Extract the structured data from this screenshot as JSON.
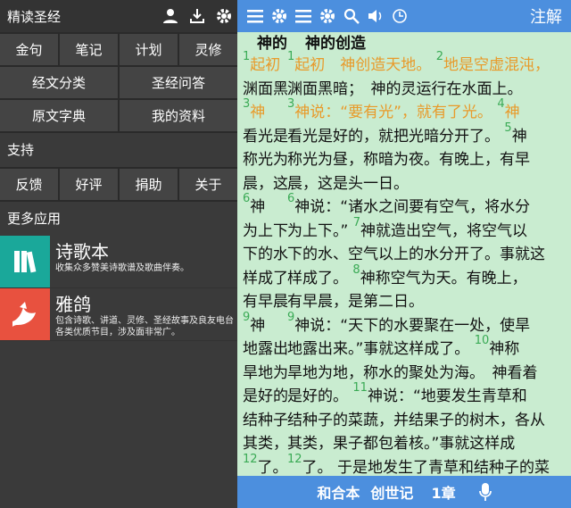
{
  "drawer": {
    "title": "精读圣经",
    "row1": [
      "金句",
      "笔记",
      "计划",
      "灵修"
    ],
    "row2": [
      "经文分类",
      "圣经问答"
    ],
    "row3": [
      "原文字典",
      "我的资料"
    ],
    "support_title": "支持",
    "support": [
      "反馈",
      "好评",
      "捐助",
      "关于"
    ],
    "more_title": "更多应用",
    "apps": [
      {
        "name": "诗歌本",
        "desc": "收集众多赞美诗歌谱及歌曲伴奏。",
        "color": "#1aa89a"
      },
      {
        "name": "雅鸽",
        "desc": "包含诗歌、讲道、灵修、圣经故事及良友电台各类优质节目，涉及面非常广。",
        "color": "#e8513f"
      }
    ]
  },
  "reader": {
    "notes": "注解",
    "heading": "神的创造",
    "partial_heading": "神的",
    "lines": [
      {
        "vn": "1",
        "text": "起初",
        "vn2": "1",
        "text2": "起初　神创造天地。",
        "vn3": "2",
        "text3": "地是空虚混沌，",
        "hl": true
      },
      {
        "text": "渊面黑",
        "text2": "渊面黑暗；　神的灵运行在水面上。"
      },
      {
        "vn": "3",
        "text": "神",
        "vn2": "3",
        "text2": "神说：“要有光”，就有了光。",
        "vn3": "4",
        "text3": "神",
        "hl": true
      },
      {
        "text": "看光是",
        "text2": "看光是好的，就把光暗分开了。",
        "vn3": "5",
        "text3": "神"
      },
      {
        "text": "称光为",
        "text2": "称光为昼，称暗为夜。有晚上，有早"
      },
      {
        "text": "晨，这",
        "text2": "晨，这是头一日。"
      },
      {
        "vn": "6",
        "text": "神",
        "vn2": "6",
        "text2": "神说：“诸水之间要有空气，将水分"
      },
      {
        "text": "为上下",
        "text2": "为上下。”",
        "vn3": "7",
        "text3": "神就造出空气，将空气以"
      },
      {
        "text": "下的水",
        "text2": "下的水、空气以上的水分开了。事就这"
      },
      {
        "text": "样成了",
        "text2": "样成了。",
        "vn3": "8",
        "text3": "神称空气为天。有晚上，"
      },
      {
        "text": "有早晨",
        "text2": "有早晨，是第二日。"
      },
      {
        "vn": "9",
        "text": "神",
        "vn2": "9",
        "text2": "神说：“天下的水要聚在一处，使旱"
      },
      {
        "text": "地露出",
        "text2": "地露出来。”事就这样成了。",
        "vn3": "10",
        "text3": "神称"
      },
      {
        "text": "旱地为",
        "text2": "旱地为地，称水的聚处为海。　神看着"
      },
      {
        "text": "是好的",
        "text2": "是好的。",
        "vn3": "11",
        "text3": "神说：“地要发生青草和"
      },
      {
        "text": "结种子",
        "text2": "结种子的菜蔬，并结果子的树木，各从"
      },
      {
        "text": "其类，",
        "text2": "其类，果子都包着核。”事就这样成"
      },
      {
        "vn": "12",
        "text": "了。",
        "vn2": "12",
        "text2": "了。",
        "text3": "于是地发生了青草和结种子的菜"
      }
    ],
    "bottom": {
      "version": "和合本",
      "book": "创世记",
      "chapter": "1章"
    }
  }
}
